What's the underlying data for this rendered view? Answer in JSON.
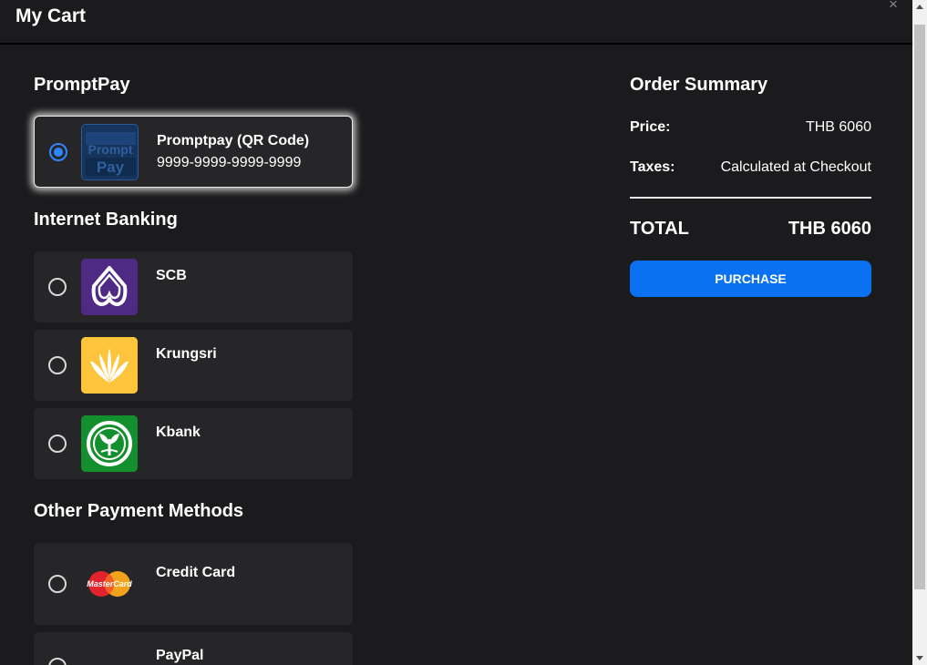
{
  "header": {
    "title": "My Cart",
    "close_label": "×"
  },
  "sections": {
    "promptpay": "PromptPay",
    "internet_banking": "Internet Banking",
    "other": "Other Payment Methods"
  },
  "methods": {
    "promptpay": {
      "name": "Promptpay (QR Code)",
      "number": "9999-9999-9999-9999",
      "logo_top": "Prompt",
      "logo_bottom": "Pay",
      "selected": true
    },
    "scb": {
      "name": "SCB",
      "color": "#4e2a84"
    },
    "krungsri": {
      "name": "Krungsri",
      "color": "#fec43b"
    },
    "kbank": {
      "name": "Kbank",
      "color": "#138f2d"
    },
    "credit_card": {
      "name": "Credit Card",
      "logo_text": "MasterCard"
    },
    "paypal": {
      "name": "PayPal"
    }
  },
  "summary": {
    "title": "Order Summary",
    "price_label": "Price:",
    "price_value": "THB 6060",
    "taxes_label": "Taxes:",
    "taxes_value": "Calculated at Checkout",
    "total_label": "TOTAL",
    "total_value": "THB 6060",
    "purchase_label": "PURCHASE"
  },
  "colors": {
    "accent": "#0a72f0",
    "radio_selected": "#2f86ff",
    "background": "#1b1b1d",
    "card": "#262628"
  }
}
